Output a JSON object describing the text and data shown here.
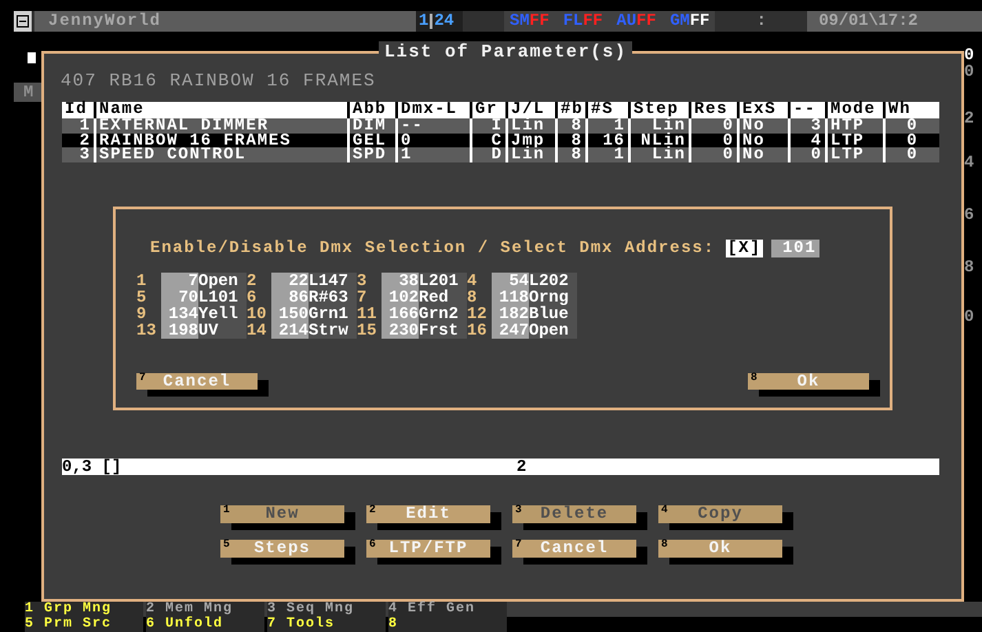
{
  "top_bar": {
    "app_title": "JennyWorld",
    "page": "1",
    "page_total": "24",
    "flags": [
      {
        "label": "SM",
        "value": "FF",
        "alert": true
      },
      {
        "label": "FL",
        "value": "FF",
        "alert": true
      },
      {
        "label": "AU",
        "value": "FF",
        "alert": true
      },
      {
        "label": "GM",
        "value": "FF",
        "alert": false
      }
    ],
    "separator": ":",
    "datetime": "09/01\\17:2"
  },
  "background": {
    "left_mark": "M",
    "right_labels": [
      "0",
      "0",
      "2",
      "4",
      "6",
      "8",
      "0"
    ]
  },
  "dialog": {
    "title": "List of Parameter(s)",
    "subtitle": "407 RB16 RAINBOW 16 FRAMES",
    "table": {
      "columns": [
        "Id",
        "Name",
        "Abb",
        "Dmx-L",
        "Gr",
        "J/L",
        "#b",
        "#S",
        "Step",
        "Res",
        "ExS",
        "--",
        "Mode",
        "Wh"
      ],
      "rows": [
        {
          "cells": [
            "1",
            "EXTERNAL DIMMER",
            "DIM",
            "--",
            "I",
            "Lin",
            "8",
            "1",
            "Lin",
            "0",
            "No",
            "3",
            "HTP",
            "0"
          ],
          "selected": false
        },
        {
          "cells": [
            "2",
            "RAINBOW 16 FRAMES",
            "GEL",
            "0",
            "C",
            "Jmp",
            "8",
            "16",
            "NLin",
            "0",
            "No",
            "4",
            "LTP",
            "0"
          ],
          "selected": true
        },
        {
          "cells": [
            "3",
            "SPEED CONTROL",
            "SPD",
            "1",
            "D",
            "Lin",
            "8",
            "1",
            "Lin",
            "0",
            "No",
            "0",
            "LTP",
            "0"
          ],
          "selected": false
        }
      ]
    },
    "status": {
      "position": "0,3 []",
      "value": "2"
    },
    "buttons": [
      {
        "key": "1",
        "label": "New",
        "disabled": true
      },
      {
        "key": "2",
        "label": "Edit",
        "disabled": false
      },
      {
        "key": "3",
        "label": "Delete",
        "disabled": true
      },
      {
        "key": "4",
        "label": "Copy",
        "disabled": true
      },
      {
        "key": "5",
        "label": "Steps",
        "disabled": false
      },
      {
        "key": "6",
        "label": "LTP/FTP",
        "disabled": false
      },
      {
        "key": "7",
        "label": "Cancel",
        "disabled": false
      },
      {
        "key": "8",
        "label": "Ok",
        "disabled": false
      }
    ]
  },
  "dmx_dialog": {
    "prompt": "Enable/Disable Dmx Selection / Select Dmx Address:",
    "checkbox": {
      "text": "[X]",
      "checked": true
    },
    "address": "101",
    "slots": [
      {
        "index": "1",
        "address": "7",
        "name": "Open"
      },
      {
        "index": "2",
        "address": "22",
        "name": "L147"
      },
      {
        "index": "3",
        "address": "38",
        "name": "L201"
      },
      {
        "index": "4",
        "address": "54",
        "name": "L202"
      },
      {
        "index": "5",
        "address": "70",
        "name": "L101"
      },
      {
        "index": "6",
        "address": "86",
        "name": "R#63"
      },
      {
        "index": "7",
        "address": "102",
        "name": "Red"
      },
      {
        "index": "8",
        "address": "118",
        "name": "Orng"
      },
      {
        "index": "9",
        "address": "134",
        "name": "Yell"
      },
      {
        "index": "10",
        "address": "150",
        "name": "Grn1"
      },
      {
        "index": "11",
        "address": "166",
        "name": "Grn2"
      },
      {
        "index": "12",
        "address": "182",
        "name": "Blue"
      },
      {
        "index": "13",
        "address": "198",
        "name": "UV"
      },
      {
        "index": "14",
        "address": "214",
        "name": "Strw"
      },
      {
        "index": "15",
        "address": "230",
        "name": "Frst"
      },
      {
        "index": "16",
        "address": "247",
        "name": "Open"
      }
    ],
    "buttons": [
      {
        "key": "7",
        "label": "Cancel"
      },
      {
        "key": "8",
        "label": "Ok"
      }
    ]
  },
  "function_key_rows": [
    {
      "keys": [
        {
          "key": "1",
          "label": "Grp Mng",
          "highlighted": true
        },
        {
          "key": "2",
          "label": "Mem Mng",
          "highlighted": false
        },
        {
          "key": "3",
          "label": "Seq Mng",
          "highlighted": false
        },
        {
          "key": "4",
          "label": "Eff Gen",
          "highlighted": false
        }
      ]
    },
    {
      "keys": [
        {
          "key": "5",
          "label": "Prm Src",
          "highlighted": true
        },
        {
          "key": "6",
          "label": "Unfold",
          "highlighted": true
        },
        {
          "key": "7",
          "label": "Tools",
          "highlighted": true
        },
        {
          "key": "8",
          "highlighted": true
        }
      ]
    }
  ]
}
